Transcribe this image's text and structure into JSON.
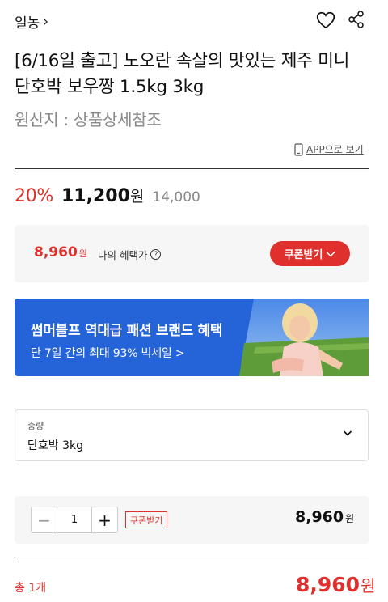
{
  "seller": {
    "name": "일농",
    "chevron": "›"
  },
  "product": {
    "title": "[6/16일 출고] 노오란 속살의 맛있는 제주 미니 단호박 보우짱 1.5kg 3kg",
    "origin": "원산지 : 상품상세참조"
  },
  "app_link": {
    "label": "APP으로 보기",
    "icon": "phone-icon"
  },
  "pricing": {
    "discount": "20%",
    "price": "11,200",
    "won": "원",
    "original": "14,000"
  },
  "benefit": {
    "price": "8,960",
    "won": "원",
    "label": "나의 혜택가",
    "help": "?",
    "coupon_button": "쿠폰받기"
  },
  "banner": {
    "title": "썸머블프 역대급 패션 브랜드 혜택",
    "subtitle": "단 7일 간의 최대 93% 빅세일 >",
    "bg_color": "#2563d9"
  },
  "option": {
    "label": "중량",
    "value": "단호박 3kg"
  },
  "quantity": {
    "minus": "−",
    "value": "1",
    "plus": "+",
    "coupon_tag": "쿠폰받기",
    "price": "8,960",
    "won": "원"
  },
  "total": {
    "label": "총 1개",
    "price": "8,960",
    "won": "원"
  },
  "colors": {
    "accent": "#e0302d",
    "banner": "#2563d9"
  }
}
